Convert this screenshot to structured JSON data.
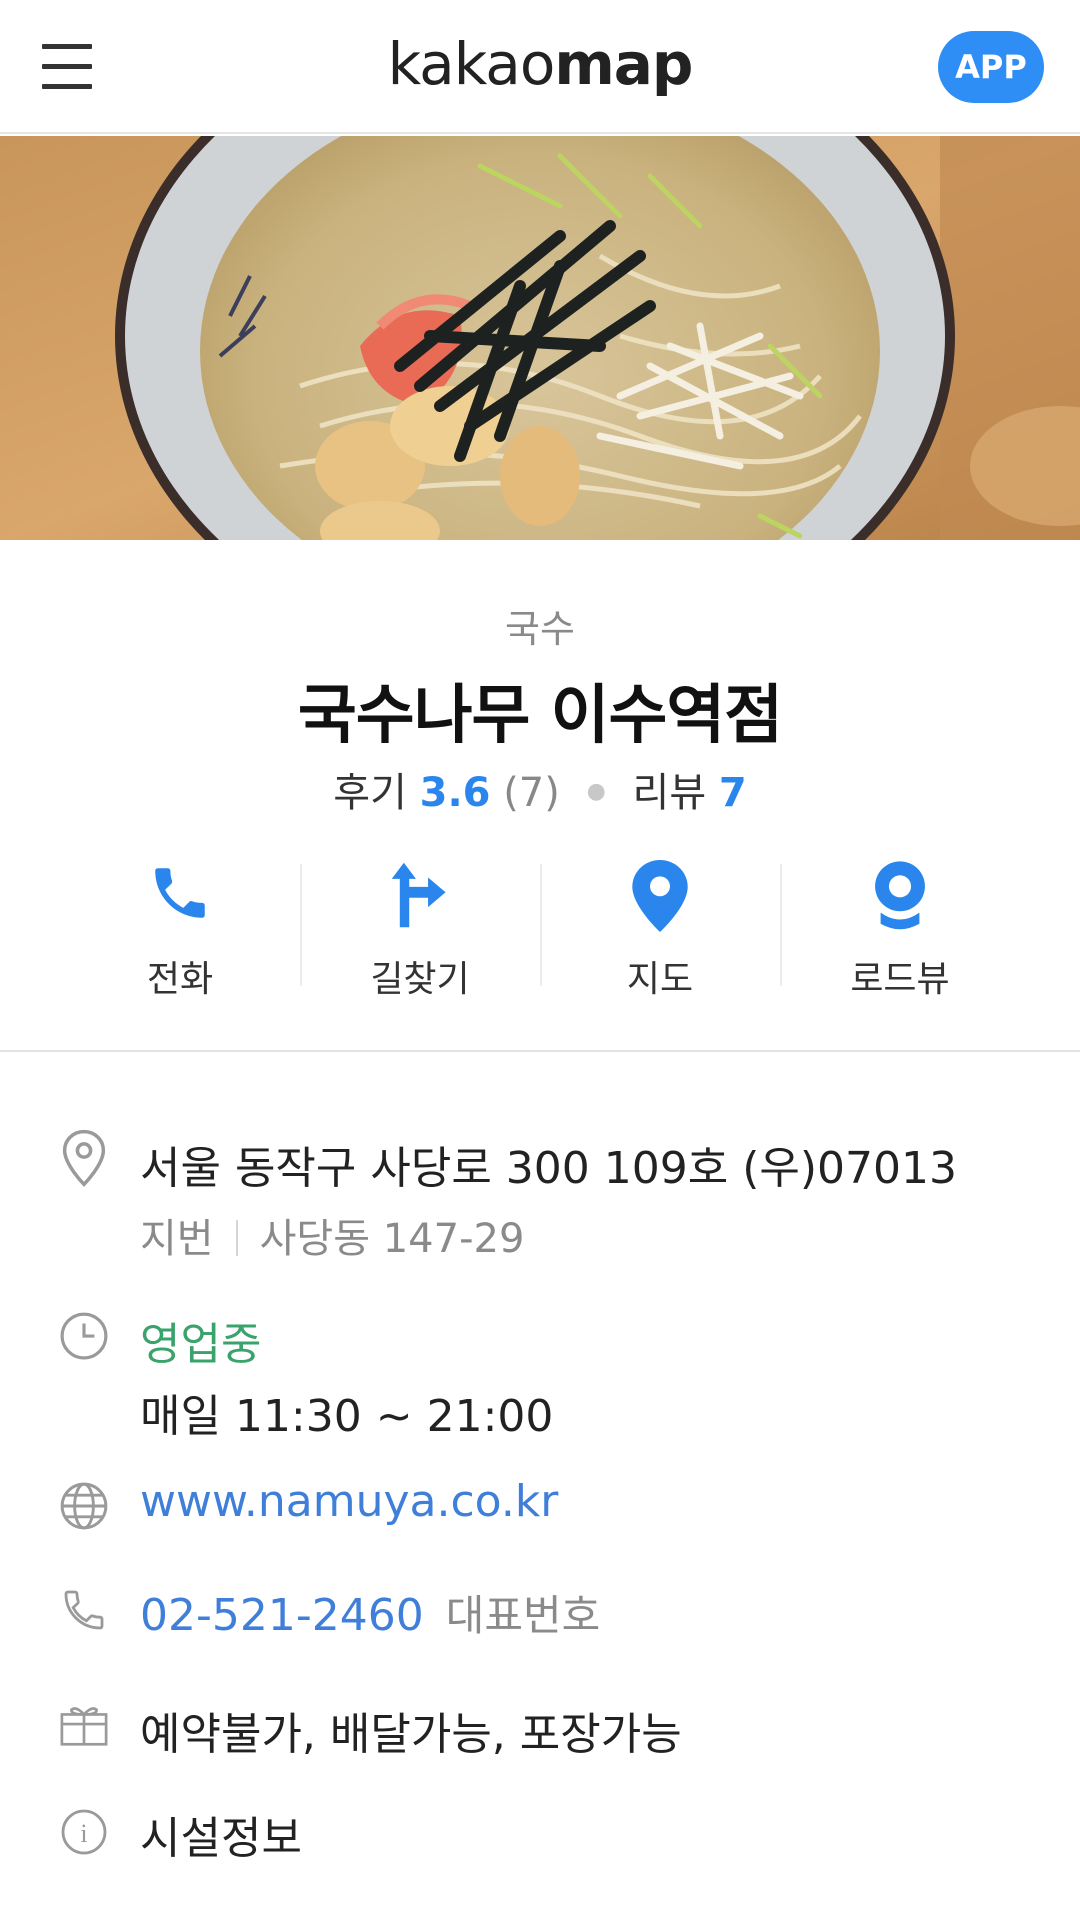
{
  "header": {
    "logo_light": "kakao",
    "logo_bold": "map",
    "app_label": "APP"
  },
  "place": {
    "category": "국수",
    "name": "국수나무 이수역점",
    "review_label": "후기",
    "review_score": "3.6",
    "review_count": "(7)",
    "blog_label": "리뷰",
    "blog_count": "7"
  },
  "actions": [
    {
      "label": "전화",
      "icon": "phone-icon"
    },
    {
      "label": "길찾기",
      "icon": "directions-icon"
    },
    {
      "label": "지도",
      "icon": "map-pin-icon"
    },
    {
      "label": "로드뷰",
      "icon": "roadview-icon"
    }
  ],
  "info": {
    "address": "서울 동작구 사당로 300 109호 (우)07013",
    "lot_label": "지번",
    "lot_address": "사당동 147-29",
    "status": "영업중",
    "hours": "매일 11:30 ~ 21:00",
    "website": "www.namuya.co.kr",
    "phone": "02-521-2460",
    "phone_note": "대표번호",
    "services": "예약불가, 배달가능, 포장가능",
    "facilities": "시설정보"
  },
  "colors": {
    "accent_blue": "#2a86ec",
    "app_button": "#2f8ef5",
    "open_green": "#3aa36b",
    "link_blue": "#3f7fd9"
  }
}
